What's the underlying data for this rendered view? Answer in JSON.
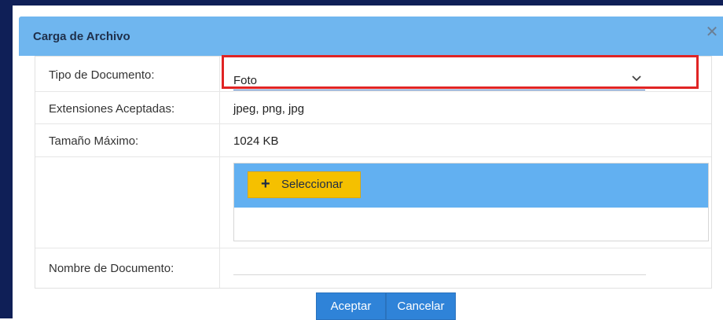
{
  "dialog": {
    "title": "Carga de Archivo",
    "close_glyph": "✕"
  },
  "form": {
    "document_type": {
      "label": "Tipo de Documento:",
      "value": "Foto"
    },
    "extensions": {
      "label": "Extensiones Aceptadas:",
      "value": "jpeg, png, jpg"
    },
    "max_size": {
      "label": "Tamaño Máximo:",
      "value": "1024 KB"
    },
    "upload": {
      "button_label": "Seleccionar",
      "button_icon": "plus-icon"
    },
    "document_name": {
      "label": "Nombre de Documento:",
      "value": ""
    }
  },
  "actions": {
    "accept_label": "Aceptar",
    "cancel_label": "Cancelar"
  },
  "colors": {
    "title_bar": "#6fb6ef",
    "upload_bar": "#62b0f1",
    "select_button": "#f5c000",
    "primary_button": "#2f83d8",
    "highlight_box": "#e02424"
  }
}
